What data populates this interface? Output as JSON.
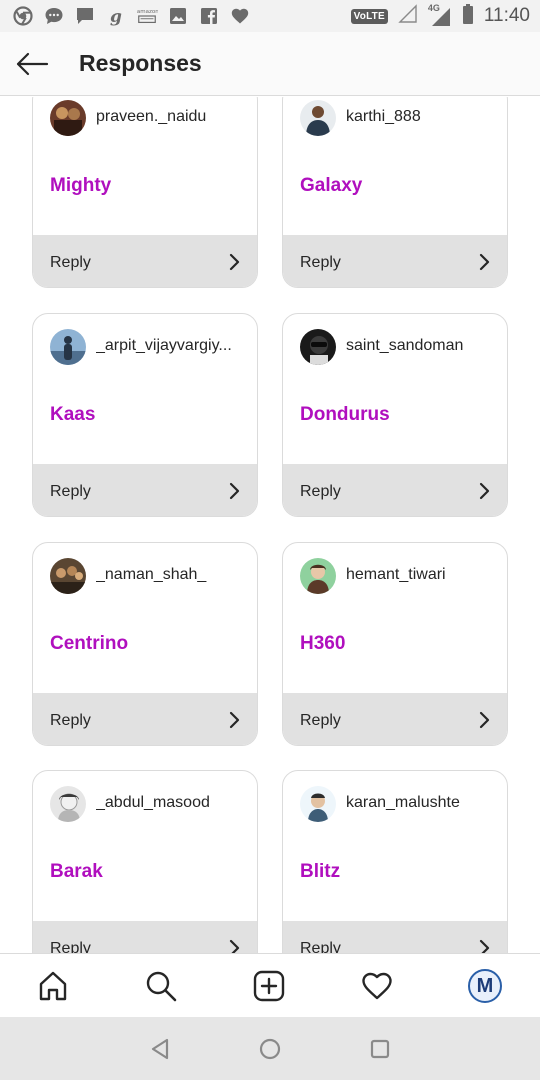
{
  "status_bar": {
    "time": "11:40",
    "volte": "VoLTE",
    "network": "4G",
    "left_icons": [
      "chrome-icon",
      "chat-icon",
      "message-icon",
      "g-icon",
      "amazon-icon",
      "gallery-icon",
      "facebook-icon",
      "heart-icon"
    ],
    "right_icons": [
      "signal-icon",
      "signal-4g-icon",
      "battery-icon"
    ]
  },
  "header": {
    "title": "Responses",
    "back_icon": "back-arrow-icon"
  },
  "colors": {
    "accent_purple": "#b00fbe",
    "footer_gray": "#e1e1e1"
  },
  "cards": [
    {
      "username": "praveen._naidu",
      "response": "Mighty",
      "reply_label": "Reply"
    },
    {
      "username": "karthi_888",
      "response": "Galaxy",
      "reply_label": "Reply"
    },
    {
      "username": "_arpit_vijayvargiy...",
      "response": "Kaas",
      "reply_label": "Reply"
    },
    {
      "username": "saint_sandoman",
      "response": "Dondurus",
      "reply_label": "Reply"
    },
    {
      "username": "_naman_shah_",
      "response": "Centrino",
      "reply_label": "Reply"
    },
    {
      "username": "hemant_tiwari",
      "response": "H360",
      "reply_label": "Reply"
    },
    {
      "username": "_abdul_masood",
      "response": "Barak",
      "reply_label": "Reply"
    },
    {
      "username": "karan_malushte",
      "response": "Blitz",
      "reply_label": "Reply"
    }
  ],
  "bottom_nav": {
    "items": [
      "home-icon",
      "search-icon",
      "add-post-icon",
      "activity-heart-icon",
      "profile-avatar"
    ],
    "profile_letter": "M"
  },
  "system_nav": [
    "back-triangle-icon",
    "home-circle-icon",
    "recents-square-icon"
  ]
}
